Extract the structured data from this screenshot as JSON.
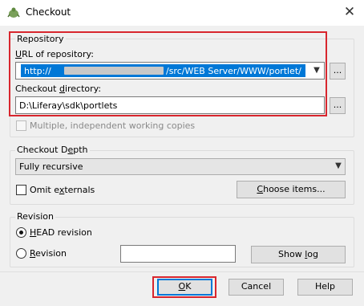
{
  "window": {
    "title": "Checkout",
    "close_glyph": "✕"
  },
  "repository": {
    "group_label": "Repository",
    "url_label": "URL of repository:",
    "url_value_prefix": "http://",
    "url_value_suffix": "/src/WEB Server/WWW/portlet/",
    "dir_label": "Checkout directory:",
    "dir_value": "D:\\Liferay\\sdk\\portlets",
    "browse_label": "...",
    "multiple_label": "Multiple, independent working copies"
  },
  "depth": {
    "group_label": "Checkout Depth",
    "value": "Fully recursive",
    "omit_externals_label": "Omit externals",
    "choose_items_label": "Choose items..."
  },
  "revision": {
    "group_label": "Revision",
    "head_label": "HEAD revision",
    "revision_label": "Revision",
    "revision_value": "",
    "show_log_label": "Show log"
  },
  "footer": {
    "ok_label": "OK",
    "cancel_label": "Cancel",
    "help_label": "Help"
  },
  "colors": {
    "highlight_red": "#d8262e",
    "selection_blue": "#0078d7"
  },
  "icons": {
    "title": "tortoisesvn-icon",
    "chevron": "chevron-down-icon"
  }
}
